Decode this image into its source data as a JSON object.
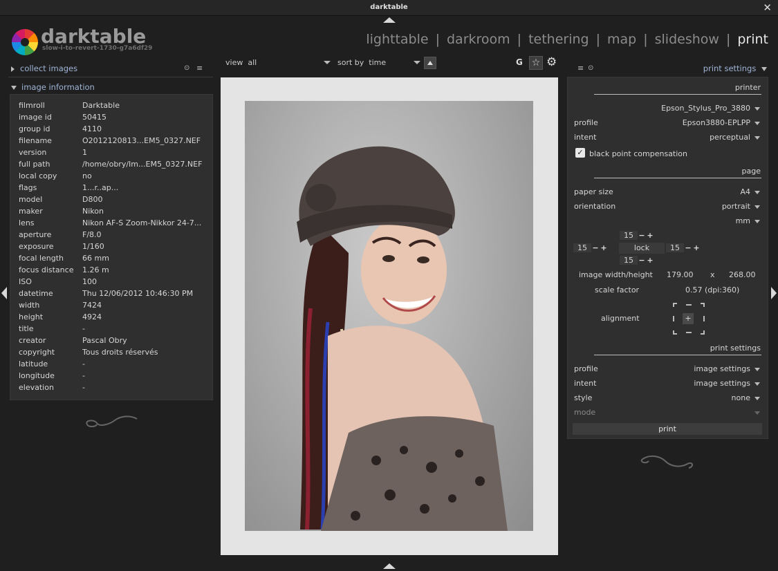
{
  "window": {
    "title": "darktable"
  },
  "header": {
    "app_name": "darktable",
    "version": "slow-i-to-revert-1730-g7a6df29",
    "views": [
      "lighttable",
      "darkroom",
      "tethering",
      "map",
      "slideshow",
      "print"
    ],
    "active_view": "print"
  },
  "left_panel": {
    "collect_label": "collect images",
    "info_label": "image information",
    "info": [
      {
        "key": "filmroll",
        "value": "Darktable"
      },
      {
        "key": "image id",
        "value": "50415"
      },
      {
        "key": "group id",
        "value": "4110"
      },
      {
        "key": "filename",
        "value": " O2012120813...EM5_0327.NEF"
      },
      {
        "key": "version",
        "value": "1"
      },
      {
        "key": "full path",
        "value": "/home/obry/Im...EM5_0327.NEF"
      },
      {
        "key": "local copy",
        "value": "no"
      },
      {
        "key": "flags",
        "value": "1...r..ap..."
      },
      {
        "key": "model",
        "value": "D800"
      },
      {
        "key": "maker",
        "value": "Nikon"
      },
      {
        "key": "lens",
        "value": "Nikon AF-S Zoom-Nikkor 24-7..."
      },
      {
        "key": "aperture",
        "value": "F/8.0"
      },
      {
        "key": "exposure",
        "value": "1/160"
      },
      {
        "key": "focal length",
        "value": "66 mm"
      },
      {
        "key": "focus distance",
        "value": "1.26 m"
      },
      {
        "key": "ISO",
        "value": "100"
      },
      {
        "key": "datetime",
        "value": "Thu 12/06/2012 10:46:30 PM"
      },
      {
        "key": "width",
        "value": "7424"
      },
      {
        "key": "height",
        "value": "4924"
      },
      {
        "key": "title",
        "value": "-"
      },
      {
        "key": "creator",
        "value": "Pascal Obry"
      },
      {
        "key": "copyright",
        "value": "Tous droits réservés"
      },
      {
        "key": "latitude",
        "value": "-"
      },
      {
        "key": "longitude",
        "value": "-"
      },
      {
        "key": "elevation",
        "value": "-"
      }
    ]
  },
  "toolbar": {
    "view_label": "view",
    "view_value": "all",
    "sort_label": "sort by",
    "sort_value": "time",
    "group_label": "G"
  },
  "right_panel": {
    "header_label": "print settings",
    "printer_section": "printer",
    "printer_name": "Epson_Stylus_Pro_3880",
    "profile_label": "profile",
    "profile_value": "Epson3880-EPLPP",
    "intent_label": "intent",
    "intent_value": "perceptual",
    "bpc_label": "black point compensation",
    "page_section": "page",
    "paper_size_label": "paper size",
    "paper_size_value": "A4",
    "orientation_label": "orientation",
    "orientation_value": "portrait",
    "unit_value": "mm",
    "margin_top": "15",
    "margin_left": "15",
    "margin_right": "15",
    "margin_bottom": "15",
    "lock_label": "lock",
    "image_wh_label": "image width/height",
    "image_width": "179.00",
    "times": "x",
    "image_height": "268.00",
    "scale_label": "scale factor",
    "scale_value": "0.57 (dpi:360)",
    "alignment_label": "alignment",
    "print_settings_section": "print settings",
    "ps_profile_label": "profile",
    "ps_profile_value": "image settings",
    "ps_intent_label": "intent",
    "ps_intent_value": "image settings",
    "style_label": "style",
    "style_value": "none",
    "mode_label": "mode",
    "print_button": "print"
  }
}
